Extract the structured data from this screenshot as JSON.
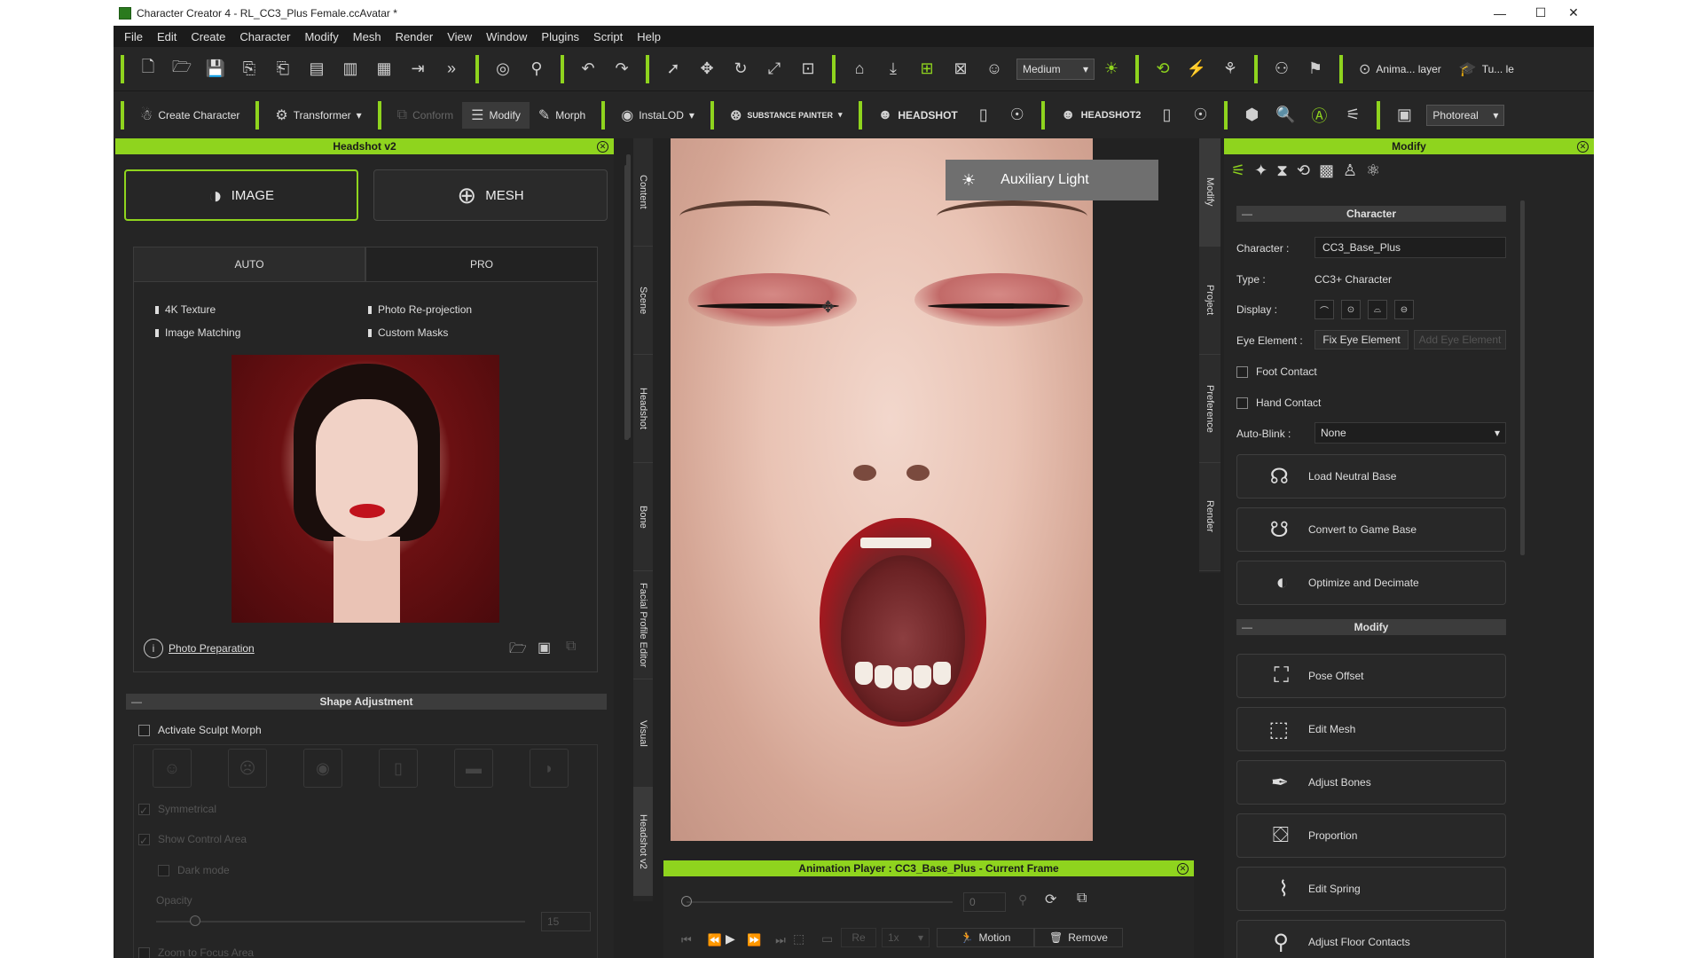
{
  "window": {
    "title": "Character Creator 4 - RL_CC3_Plus Female.ccAvatar *",
    "controls": [
      "—",
      "☐",
      "✕"
    ]
  },
  "menu": [
    "File",
    "Edit",
    "Create",
    "Character",
    "Modify",
    "Mesh",
    "Render",
    "View",
    "Window",
    "Plugins",
    "Script",
    "Help"
  ],
  "toolbar1": {
    "quality": "Medium",
    "anim_layer": "Anima... layer",
    "tu_le": "Tu... le"
  },
  "toolbar2": {
    "create_character": "Create Character",
    "transformer": "Transformer",
    "conform": "Conform",
    "modify": "Modify",
    "morph": "Morph",
    "instalod": "InstaLOD",
    "substance": "SUBSTANCE PAINTER",
    "headshot": "HEADSHOT",
    "headshot2": "HEADSHOT2",
    "render_mode": "Photoreal"
  },
  "left_panel": {
    "title": "Headshot v2",
    "image_label": "IMAGE",
    "mesh_label": "MESH",
    "tabs": [
      "AUTO",
      "PRO"
    ],
    "features": [
      "4K Texture",
      "Photo Re-projection",
      "Image Matching",
      "Custom Masks"
    ],
    "photo_preparation": "Photo Preparation",
    "shape_adjustment": "Shape Adjustment",
    "activate_sculpt_morph": "Activate Sculpt Morph",
    "symmetrical": "Symmetrical",
    "show_control_area": "Show Control Area",
    "dark_mode": "Dark mode",
    "opacity": "Opacity",
    "opacity_value": "15",
    "zoom_to_focus": "Zoom to Focus Area"
  },
  "side_tabs": [
    "Content",
    "Scene",
    "Headshot",
    "Bone",
    "Facial Profile Editor",
    "Visual",
    "Headshot v2"
  ],
  "viewport": {
    "aux_light": "Auxiliary Light"
  },
  "anim_player": {
    "title": "Animation Player : CC3_Base_Plus - Current Frame",
    "frame": "0",
    "re_label": "Re",
    "speed": "1x",
    "motion": "Motion",
    "remove": "Remove"
  },
  "right_tabs": [
    "Modify",
    "Project",
    "Preference",
    "Render"
  ],
  "right_panel": {
    "title": "Modify",
    "character_section": "Character",
    "character_label": "Character :",
    "character_value": "CC3_Base_Plus",
    "type_label": "Type :",
    "type_value": "CC3+ Character",
    "display_label": "Display :",
    "eye_element_label": "Eye Element :",
    "fix_eye": "Fix Eye Element",
    "add_eye": "Add Eye Element",
    "foot_contact": "Foot Contact",
    "hand_contact": "Hand Contact",
    "auto_blink_label": "Auto-Blink :",
    "auto_blink_value": "None",
    "buttons_top": [
      "Load Neutral Base",
      "Convert to Game Base",
      "Optimize and Decimate"
    ],
    "modify_section": "Modify",
    "buttons_modify": [
      "Pose Offset",
      "Edit Mesh",
      "Adjust Bones",
      "Proportion",
      "Edit Spring",
      "Adjust Floor Contacts"
    ]
  },
  "colors": {
    "accent": "#8fd41e",
    "panel": "#252525",
    "lips": "#c0121d"
  }
}
